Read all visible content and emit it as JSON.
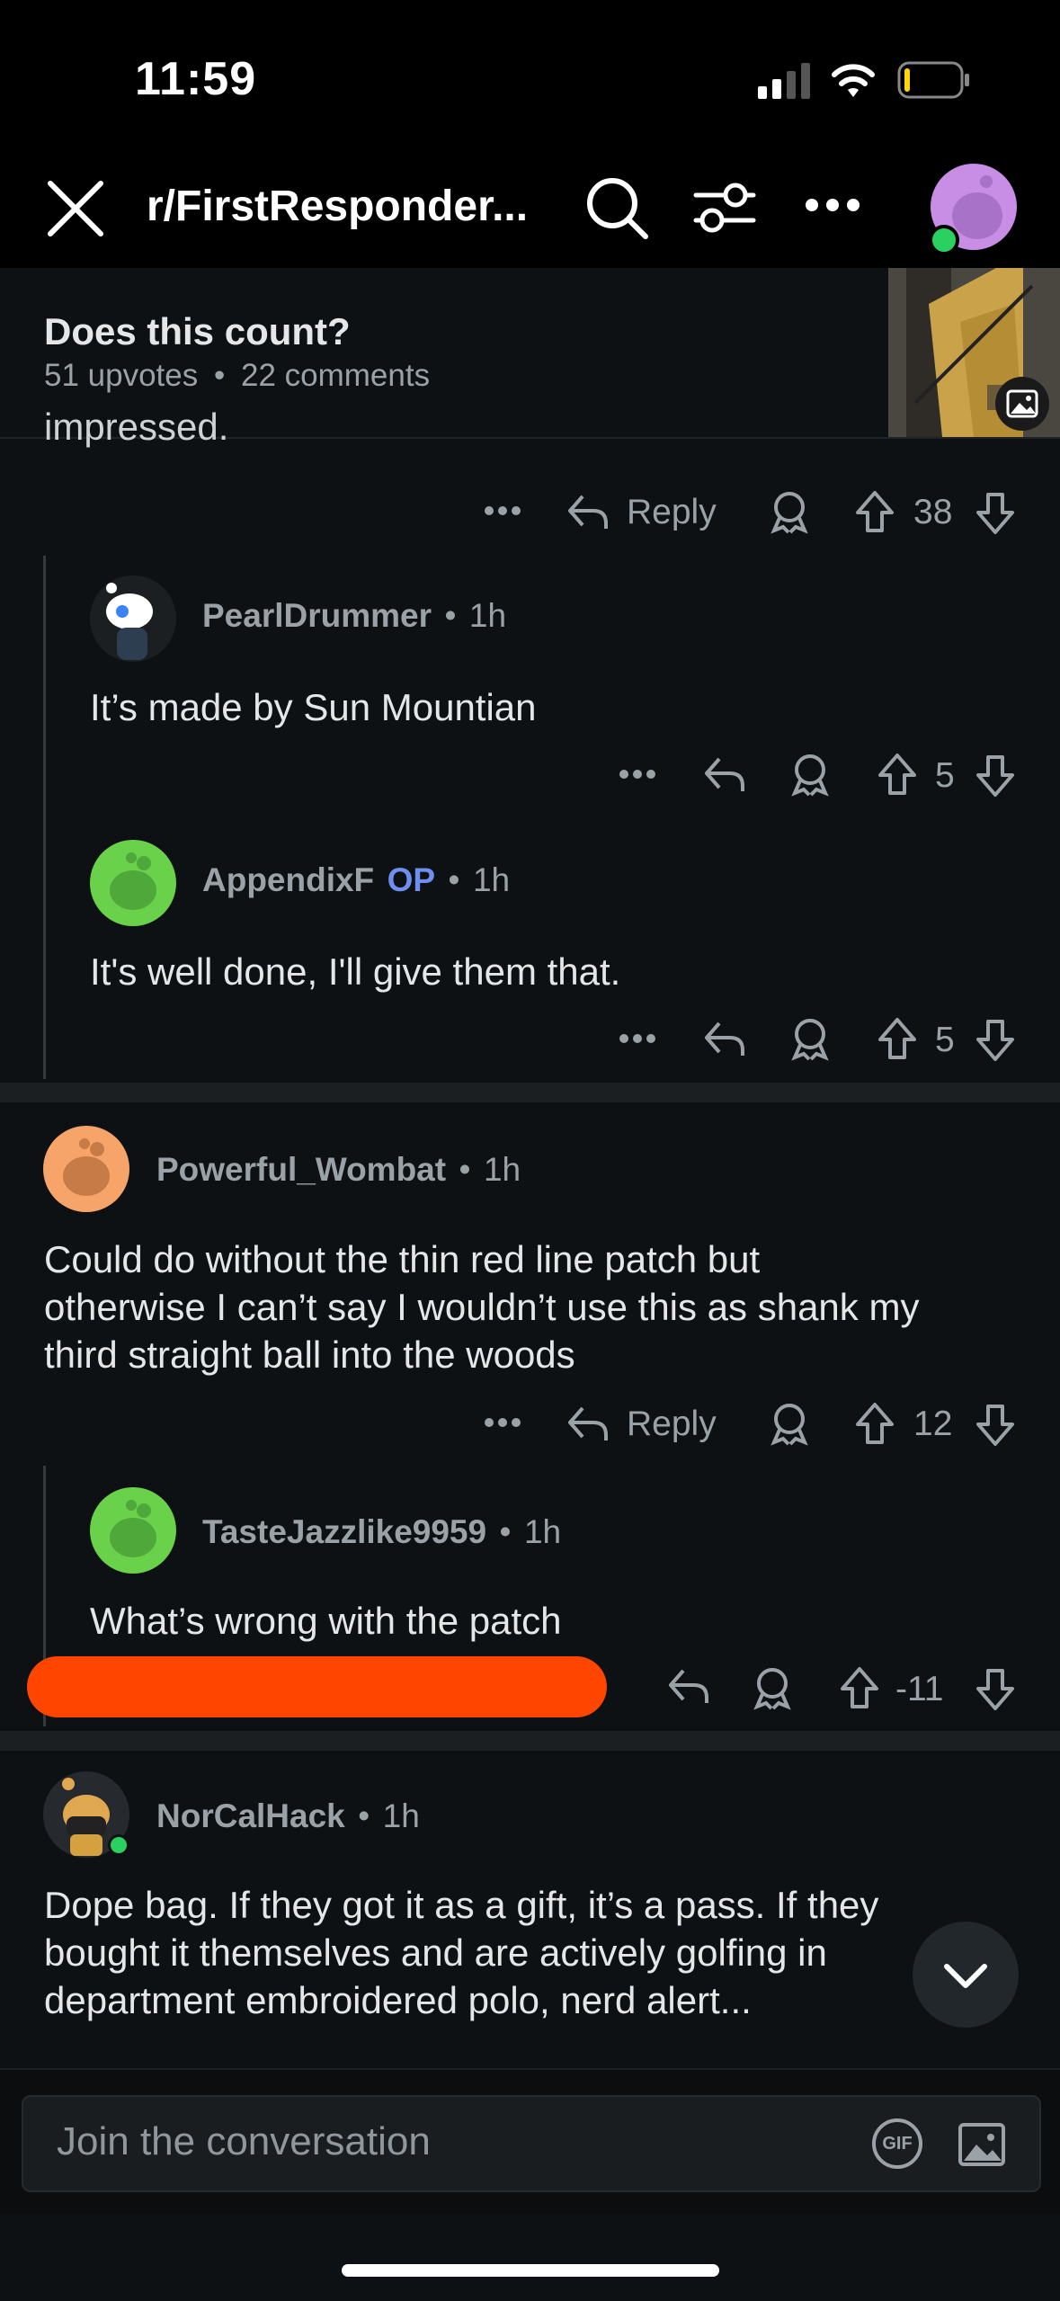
{
  "status_bar": {
    "time": "11:59"
  },
  "header": {
    "subreddit": "r/FirstResponder..."
  },
  "post": {
    "title": "Does this count?",
    "upvotes": "51 upvotes",
    "comments": "22 comments",
    "meta_sep": "•"
  },
  "partial_text": "impressed.",
  "top_actions": {
    "reply": "Reply",
    "score": "38"
  },
  "comments": [
    {
      "user": "PearlDrummer",
      "time": "1h",
      "body": "It’s made by Sun Mountian",
      "score": "5"
    },
    {
      "user": "AppendixF",
      "op": "OP",
      "time": "1h",
      "body": "It's well done, I'll give them that.",
      "score": "5"
    },
    {
      "user": "Powerful_Wombat",
      "time": "1h",
      "body": [
        "Could do without the thin red line patch but",
        "otherwise I can’t say I wouldn’t use this as shank my",
        "third straight ball into the woods"
      ],
      "reply": "Reply",
      "score": "12"
    },
    {
      "user": "TasteJazzlike9959",
      "time": "1h",
      "body": "What’s wrong with the patch",
      "score": "-11"
    },
    {
      "user": "NorCalHack",
      "time": "1h",
      "body": [
        "Dope bag. If they got it as a gift, it’s a pass. If they",
        "bought it themselves and are actively golfing in",
        "department embroidered polo, nerd alert..."
      ]
    }
  ],
  "dot": "•",
  "composer": {
    "placeholder": "Join the conversation",
    "gif": "GIF"
  },
  "colors": {
    "op_blue": "#6f8ff0",
    "redact_orange": "#ff4500",
    "online_green": "#2bd160"
  }
}
